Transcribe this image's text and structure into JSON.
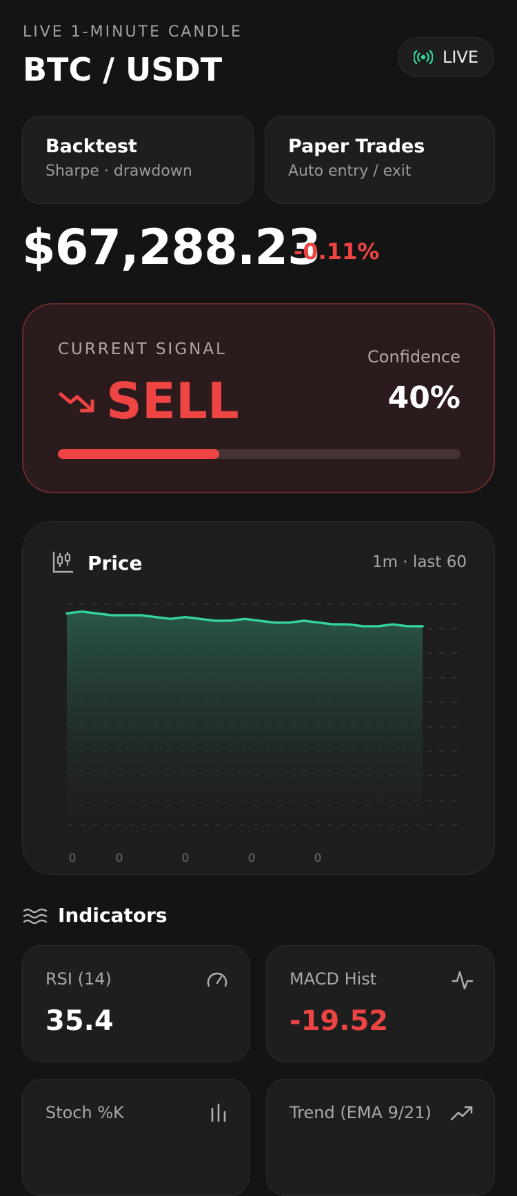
{
  "header": {
    "eyebrow": "LIVE 1-MINUTE CANDLE",
    "pair": "BTC / USDT",
    "live_label": "LIVE"
  },
  "nav_cards": [
    {
      "title": "Backtest",
      "subtitle": "Sharpe · drawdown"
    },
    {
      "title": "Paper Trades",
      "subtitle": "Auto entry / exit"
    }
  ],
  "price": {
    "value": "$67,288.23",
    "change": "-0.11%"
  },
  "signal": {
    "label": "CURRENT SIGNAL",
    "value": "SELL",
    "confidence_label": "Confidence",
    "confidence_value": "40%",
    "confidence_fraction": 0.4
  },
  "chart": {
    "title": "Price",
    "meta": "1m · last 60"
  },
  "chart_data": {
    "type": "area",
    "x_tick_labels": [
      "0",
      "0",
      "0",
      "0",
      "0"
    ],
    "values": [
      67295,
      67296,
      67295,
      67294,
      67294,
      67294,
      67293,
      67292,
      67293,
      67292,
      67291,
      67291,
      67292,
      67291,
      67290,
      67290,
      67291,
      67290,
      67289,
      67289,
      67288,
      67288,
      67289,
      67288,
      67288
    ],
    "ylim": [
      67180,
      67300
    ],
    "grid": true,
    "line_color": "#34d399"
  },
  "indicators": {
    "title": "Indicators",
    "items": [
      {
        "label": "RSI (14)",
        "value": "35.4",
        "icon": "gauge-icon"
      },
      {
        "label": "MACD Hist",
        "value": "-19.52",
        "icon": "pulse-icon"
      },
      {
        "label": "Stoch %K",
        "value": "",
        "icon": "bars-icon"
      },
      {
        "label": "Trend (EMA 9/21)",
        "value": "",
        "icon": "trending-icon"
      }
    ]
  },
  "colors": {
    "background": "#141414",
    "card": "#1e1e1e",
    "negative": "#ef4444",
    "positive": "#34d399"
  }
}
